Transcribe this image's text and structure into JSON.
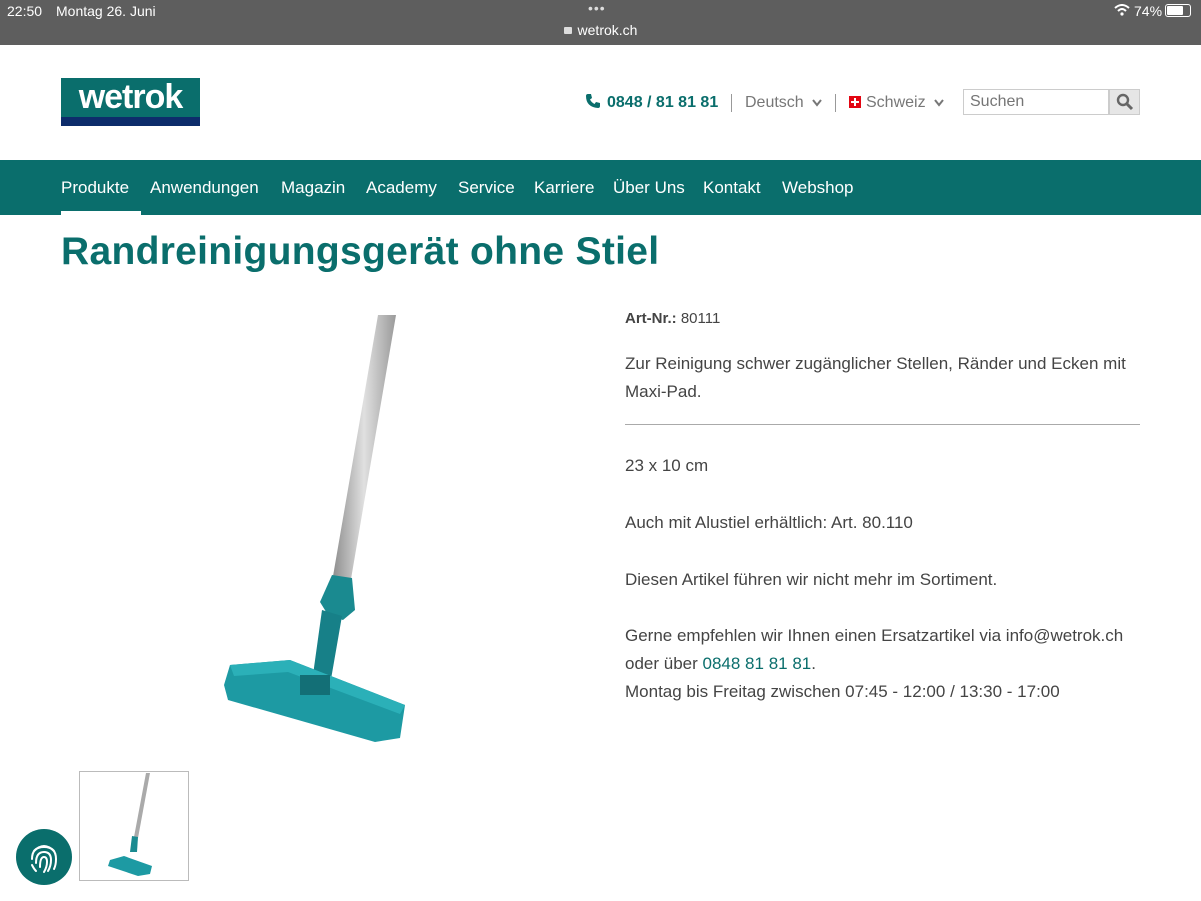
{
  "status_bar": {
    "time": "22:50",
    "date": "Montag 26. Juni",
    "url": "wetrok.ch",
    "battery": "74%"
  },
  "header": {
    "logo_text": "wetrok",
    "phone": "0848 / 81 81 81",
    "language": "Deutsch",
    "country": "Schweiz",
    "search_placeholder": "Suchen"
  },
  "nav": {
    "items": [
      "Produkte",
      "Anwendungen",
      "Magazin",
      "Academy",
      "Service",
      "Karriere",
      "Über Uns",
      "Kontakt",
      "Webshop"
    ],
    "active": "Produkte"
  },
  "product": {
    "title": "Randreinigungsgerät ohne Stiel",
    "art_label": "Art-Nr.:",
    "art_nr": "80111",
    "description": "Zur Reinigung schwer zugänglicher Stellen, Ränder und Ecken mit Maxi-Pad.",
    "size": "23 x 10 cm",
    "alt_article": "Auch mit Alustiel erhältlich: Art. 80.110",
    "discontinued": "Diesen Artikel führen wir nicht mehr im Sortiment.",
    "contact_text_1": "Gerne empfehlen wir Ihnen einen Ersatzartikel via info@wetrok.ch oder über",
    "contact_phone": "0848 81 81 81",
    "contact_period": ".",
    "hours": "Montag bis Freitag zwischen 07:45 - 12:00 / 13:30 - 17:00"
  },
  "colors": {
    "brand": "#0a6e6c",
    "logo_bar": "#0d2c6b",
    "statusbar": "#5e5e5e"
  }
}
